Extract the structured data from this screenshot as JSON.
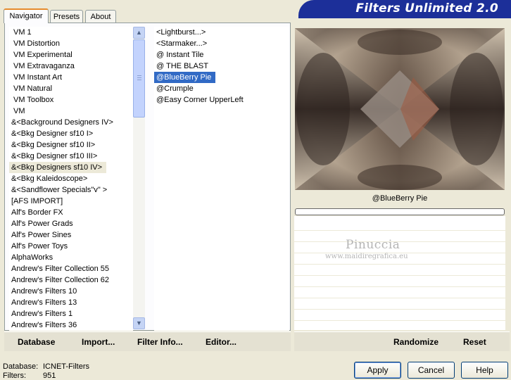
{
  "tabs": [
    "Navigator",
    "Presets",
    "About"
  ],
  "banner_title": "Filters Unlimited 2.0",
  "categories": [
    "VM 1",
    "VM Distortion",
    "VM Experimental",
    "VM Extravaganza",
    "VM Instant Art",
    "VM Natural",
    "VM Toolbox",
    "VM",
    "&<Background Designers IV>",
    "&<Bkg Designer sf10 I>",
    "&<Bkg Designer sf10 II>",
    "&<Bkg Designer sf10 III>",
    "&<Bkg Designers sf10 IV>",
    "&<Bkg Kaleidoscope>",
    "&<Sandflower Specials\"v\" >",
    "[AFS IMPORT]",
    "Alf's Border FX",
    "Alf's Power Grads",
    "Alf's Power Sines",
    "Alf's Power Toys",
    "AlphaWorks",
    "Andrew's Filter Collection 55",
    "Andrew's Filter Collection 62",
    "Andrew's Filters 10",
    "Andrew's Filters 13",
    "Andrew's Filters 1",
    "Andrew's Filters 36"
  ],
  "selected_category_index": 12,
  "filters": [
    "<Lightburst...>",
    "<Starmaker...>",
    "@ Instant Tile",
    "@ THE BLAST",
    "@BlueBerry Pie",
    "@Crumple",
    "@Easy Corner UpperLeft"
  ],
  "selected_filter_index": 4,
  "preview_filter_name": "@BlueBerry Pie",
  "watermark": {
    "main": "Pinuccia",
    "sub": "www.maidiregrafica.eu"
  },
  "toolbar_left": {
    "database": "Database",
    "import": "Import...",
    "filter_info": "Filter Info...",
    "editor": "Editor..."
  },
  "toolbar_right": {
    "randomize": "Randomize",
    "reset": "Reset"
  },
  "status": {
    "database_label": "Database:",
    "database_value": "ICNET-Filters",
    "filters_label": "Filters:",
    "filters_value": "951"
  },
  "buttons": {
    "apply": "Apply",
    "cancel": "Cancel",
    "help": "Help"
  },
  "colors": {
    "banner": "#1c2f99",
    "selection": "#316ac5",
    "tab_accent": "#e68b2c"
  },
  "icons": {
    "scroll_up": "chevron-up-icon",
    "scroll_down": "chevron-down-icon"
  }
}
